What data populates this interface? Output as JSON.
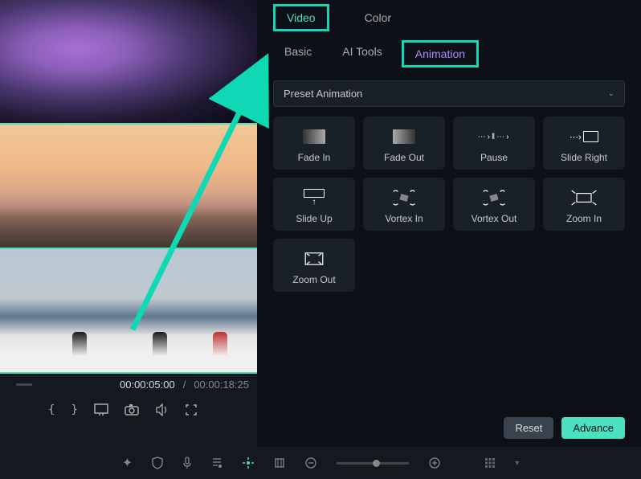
{
  "left": {
    "time_current": "00:00:05:00",
    "time_total": "00:00:18:25"
  },
  "tabs": {
    "video": "Video",
    "color": "Color"
  },
  "subtabs": {
    "basic": "Basic",
    "aitools": "AI Tools",
    "animation": "Animation"
  },
  "dropdown": {
    "label": "Preset Animation"
  },
  "presets": [
    {
      "label": "Fade In"
    },
    {
      "label": "Fade Out"
    },
    {
      "label": "Pause"
    },
    {
      "label": "Slide Right"
    },
    {
      "label": "Slide Up"
    },
    {
      "label": "Vortex In"
    },
    {
      "label": "Vortex Out"
    },
    {
      "label": "Zoom In"
    },
    {
      "label": "Zoom Out"
    }
  ],
  "buttons": {
    "reset": "Reset",
    "advance": "Advance"
  }
}
